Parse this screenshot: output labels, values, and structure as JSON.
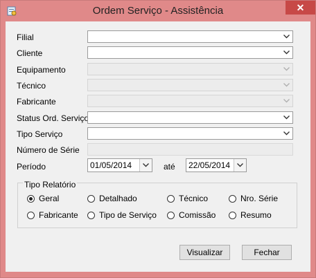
{
  "window": {
    "title": "Ordem Serviço - Assistência",
    "close_symbol": "✕",
    "icon": "app-icon"
  },
  "filters": {
    "filial": {
      "label": "Filial",
      "value": ""
    },
    "cliente": {
      "label": "Cliente",
      "value": ""
    },
    "equipamento": {
      "label": "Equipamento",
      "value": ""
    },
    "tecnico": {
      "label": "Técnico",
      "value": ""
    },
    "fabricante": {
      "label": "Fabricante",
      "value": ""
    },
    "status": {
      "label": "Status Ord. Serviço",
      "value": ""
    },
    "tipo_servico": {
      "label": "Tipo Serviço",
      "value": ""
    },
    "numero_serie": {
      "label": "Número de Série",
      "value": ""
    }
  },
  "periodo": {
    "label": "Período",
    "start": "01/05/2014",
    "separator": "até",
    "end": "22/05/2014"
  },
  "tipo_relatorio": {
    "legend": "Tipo Relatório",
    "options": [
      "Geral",
      "Detalhado",
      "Técnico",
      "Nro. Série",
      "Fabricante",
      "Tipo de Serviço",
      "Comissão",
      "Resumo"
    ],
    "selected": "Geral"
  },
  "buttons": {
    "visualizar": "Visualizar",
    "fechar": "Fechar"
  },
  "colors": {
    "titlebar": "#e08989",
    "close": "#c74947",
    "client": "#f0f0f0"
  }
}
